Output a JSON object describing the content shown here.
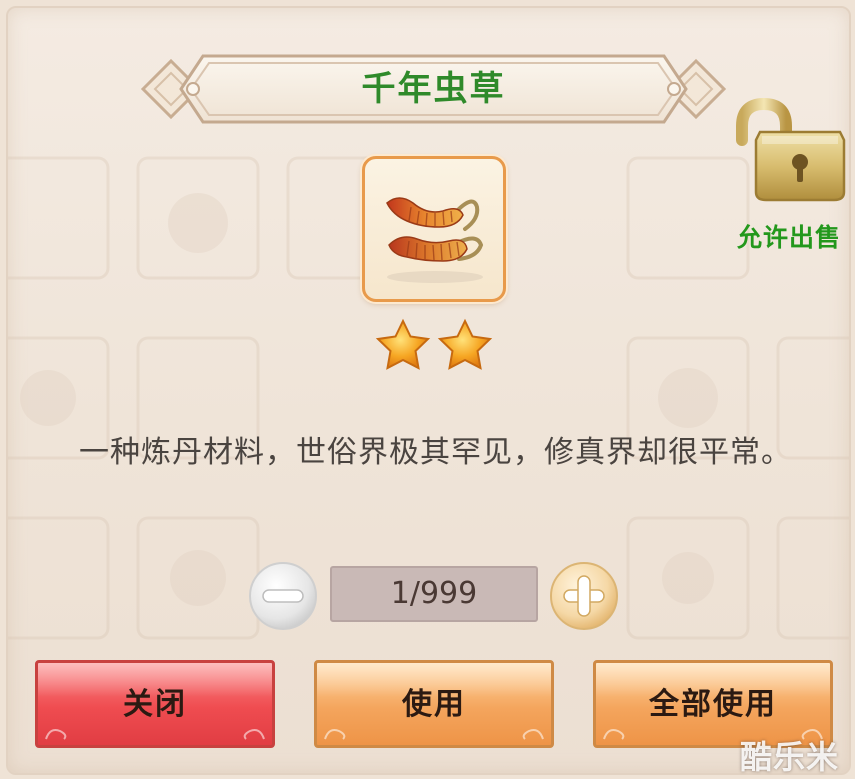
{
  "item": {
    "title": "千年虫草",
    "icon": "cordyceps-icon",
    "stars": 2,
    "description": "一种炼丹材料，世俗界极其罕见，修真界却很平常。"
  },
  "sell": {
    "label": "允许出售",
    "icon": "open-lock-icon"
  },
  "quantity": {
    "value": "1/999",
    "minus_icon": "minus-icon",
    "plus_icon": "plus-icon"
  },
  "buttons": {
    "close": "关闭",
    "use": "使用",
    "use_all": "全部使用"
  },
  "watermark": "酷乐米",
  "colors": {
    "title_green": "#2f8a2a",
    "close_red": "#ef4c50",
    "action_orange": "#f4a55d",
    "star_gold": "#f6a623"
  }
}
